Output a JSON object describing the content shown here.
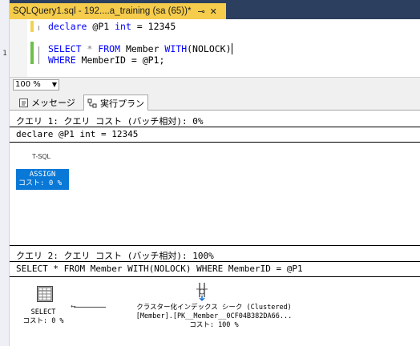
{
  "document_tab": {
    "title": "SQLQuery1.sql - 192....a_training (sa (65))*",
    "pin_icon": "pin-icon",
    "close_icon": "close-icon"
  },
  "gutter_mark": "1",
  "editor": {
    "lines": [
      {
        "kw": "declare",
        "rest": " @P1 ",
        "kw2": "int",
        "rest2": " = 12345"
      },
      {
        "kw": "SELECT",
        "rest": " * ",
        "kw2": "FROM",
        "rest2": " Member ",
        "kw3": "WITH",
        "rest3": "(NOLOCK)"
      },
      {
        "kw": "WHERE",
        "rest": " MemberID = @P1;"
      }
    ]
  },
  "zoom": {
    "value": "100 %"
  },
  "results_tabs": [
    {
      "label": "メッセージ",
      "icon": "messages-icon"
    },
    {
      "label": "実行プラン",
      "icon": "execution-plan-icon"
    }
  ],
  "plan": {
    "query1": {
      "header": "クエリ 1: クエリ コスト (バッチ相対): 0%",
      "statement": "declare @P1 int = 12345",
      "tsql_label": "T-SQL",
      "operator": {
        "name": "ASSIGN",
        "cost": "コスト: 0 %"
      }
    },
    "query2": {
      "header": "クエリ 2: クエリ コスト (バッチ相対): 100%",
      "statement": "SELECT * FROM Member WITH(NOLOCK) WHERE MemberID = @P1",
      "select_op": {
        "name": "SELECT",
        "cost": "コスト: 0 %",
        "icon": "select-operator-icon"
      },
      "seek_op": {
        "name": "クラスター化インデックス シーク (Clustered)",
        "object": "[Member].[PK__Member__0CF04B382DA66...",
        "cost": "コスト: 100 %",
        "icon": "clustered-index-seek-icon"
      }
    }
  },
  "colors": {
    "tab_active": "#f5cc4b",
    "ide_frame": "#2d3f5f",
    "assign_selected": "#0a78d6",
    "keyword": "#0000ff"
  }
}
